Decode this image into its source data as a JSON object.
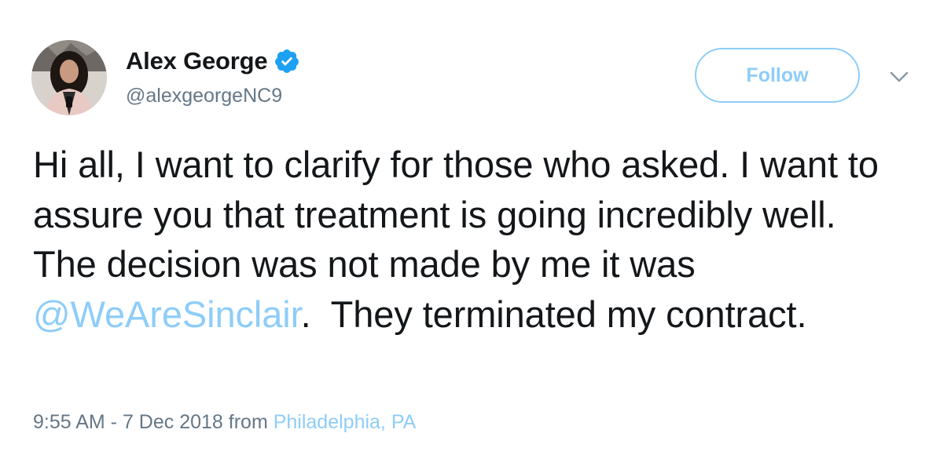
{
  "user": {
    "display_name": "Alex George",
    "handle": "@alexgeorgeNC9",
    "avatar_icon": "profile-photo",
    "verified_icon": "verified-badge-icon",
    "verified_color": "#1da1f2"
  },
  "follow_button": {
    "label": "Follow",
    "color": "#8ecdf8"
  },
  "menu_icon": "chevron-down-icon",
  "tweet": {
    "text_before_mention": "Hi all, I want to clarify for those who asked. I want to assure you that treatment is going incredibly well.  The decision was not made by me it was ",
    "mention": "@WeAreSinclair",
    "text_after_mention": ".  They terminated my contract."
  },
  "meta": {
    "timestamp": "9:55 AM - 7 Dec 2018",
    "from_label": "from",
    "location": "Philadelphia, PA"
  }
}
